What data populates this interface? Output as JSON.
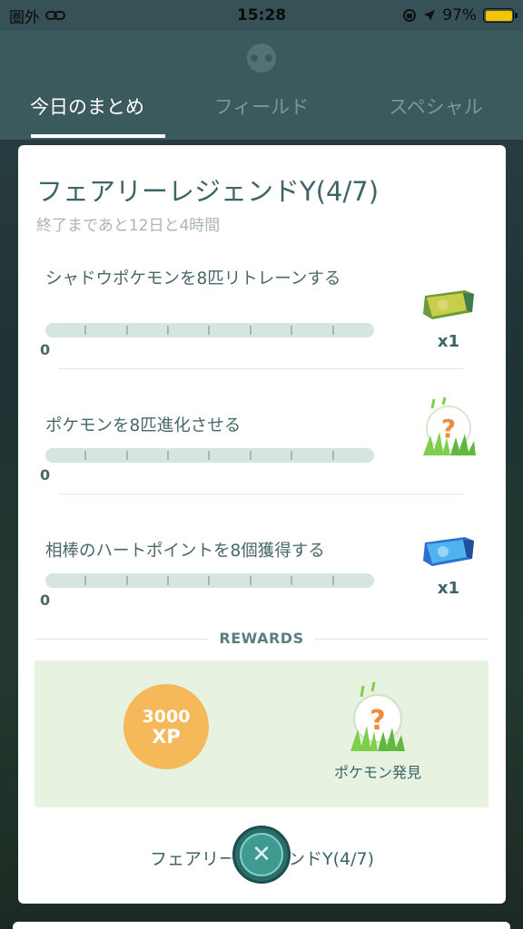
{
  "status_bar": {
    "carrier": "圏外",
    "time": "15:28",
    "battery_percent": "97%"
  },
  "tabs": [
    {
      "label": "今日のまとめ",
      "active": true
    },
    {
      "label": "フィールド",
      "active": false
    },
    {
      "label": "スペシャル",
      "active": false
    }
  ],
  "research": {
    "title": "フェアリーレジェンドY(4/7)",
    "subtitle": "終了まであと12日と4時間",
    "tasks": [
      {
        "label": "シャドウポケモンを8匹リトレーンする",
        "progress": "0",
        "reward_icon": "tm-green-item-icon",
        "reward_count": "x1"
      },
      {
        "label": "ポケモンを8匹進化させる",
        "progress": "0",
        "reward_icon": "pokemon-encounter-icon",
        "reward_count": ""
      },
      {
        "label": "相棒のハートポイントを8個獲得する",
        "progress": "0",
        "reward_icon": "tm-blue-item-icon",
        "reward_count": "x1"
      }
    ],
    "rewards_heading": "REWARDS",
    "rewards": {
      "xp_amount": "3000",
      "xp_unit": "XP",
      "pokemon_label": "ポケモン発見"
    },
    "footer_title": "フェアリーレジェンドY(4/7)"
  },
  "colors": {
    "accent": "#3d6466",
    "progress_track": "#d6e4e2",
    "xp_badge": "#f5b95a",
    "rewards_bg": "#e8f2e0"
  }
}
